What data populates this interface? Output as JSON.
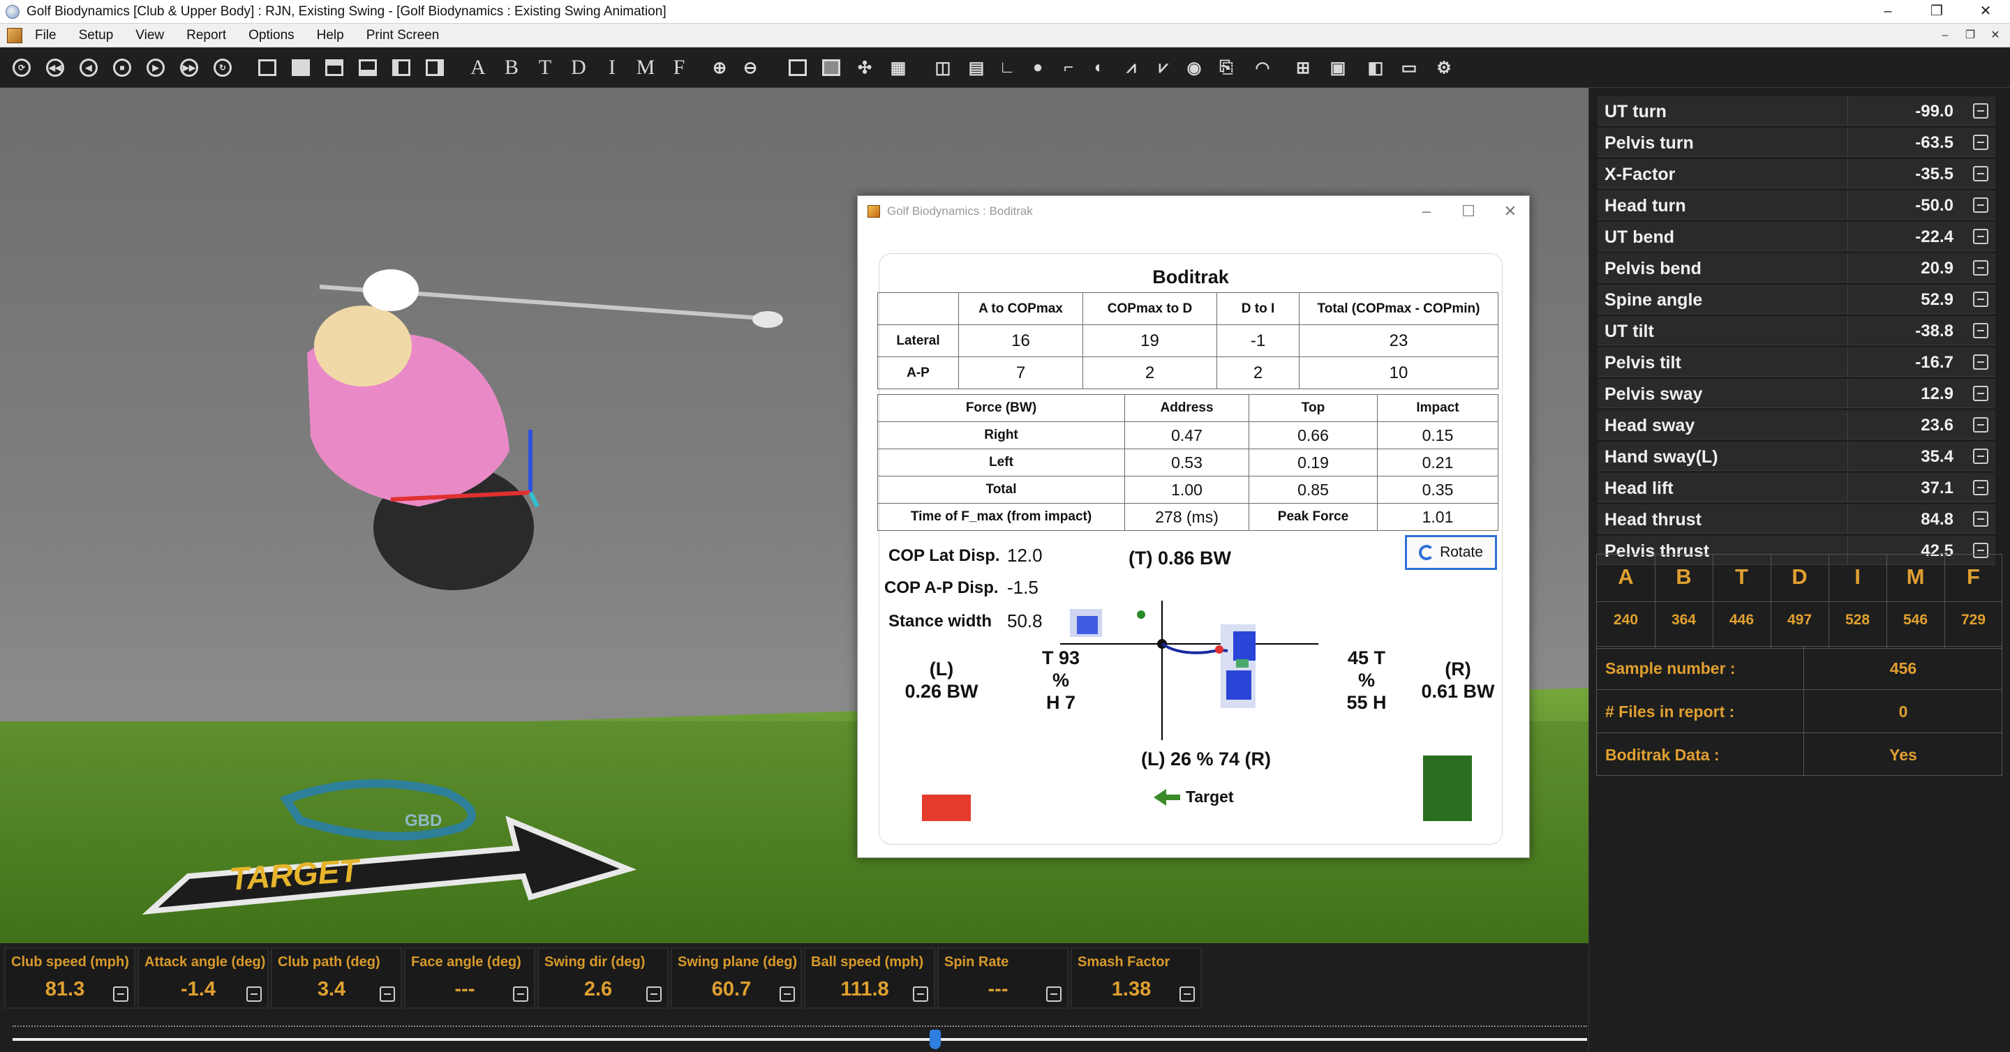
{
  "window": {
    "title": "Golf Biodynamics [Club & Upper Body] : RJN, Existing Swing - [Golf Biodynamics : Existing Swing Animation]",
    "minimize": "–",
    "maximize": "❐",
    "close": "✕"
  },
  "menu": {
    "items": [
      "File",
      "Setup",
      "View",
      "Report",
      "Options",
      "Help",
      "Print Screen"
    ],
    "mdi_minimize": "–",
    "mdi_restore": "❐",
    "mdi_close": "✕"
  },
  "toolbar": {
    "letters": [
      "A",
      "B",
      "T",
      "D",
      "I",
      "M",
      "F"
    ]
  },
  "viewport": {
    "target_sign": "TARGET",
    "logo": "GBD"
  },
  "boditrak": {
    "window_title": "Golf Biodynamics : Boditrak",
    "heading": "Boditrak",
    "table1": {
      "headers": [
        "",
        "A to COPmax",
        "COPmax to D",
        "D to I",
        "Total (COPmax - COPmin)"
      ],
      "rows": [
        {
          "label": "Lateral",
          "values": [
            "16",
            "19",
            "-1",
            "23"
          ]
        },
        {
          "label": "A-P",
          "values": [
            "7",
            "2",
            "2",
            "10"
          ]
        }
      ]
    },
    "table2": {
      "headers": [
        "Force (BW)",
        "Address",
        "Top",
        "Impact"
      ],
      "rows": [
        {
          "label": "Right",
          "values": [
            "0.47",
            "0.66",
            "0.15"
          ]
        },
        {
          "label": "Left",
          "values": [
            "0.53",
            "0.19",
            "0.21"
          ]
        },
        {
          "label": "Total",
          "values": [
            "1.00",
            "0.85",
            "0.35"
          ]
        }
      ],
      "fmax_label": "Time of F_max (from impact)",
      "fmax_value": "278 (ms)",
      "peak_label": "Peak Force",
      "peak_value": "1.01"
    },
    "cop_lat_label": "COP Lat Disp.",
    "cop_lat_value": "12.0",
    "cop_ap_label": "COP A-P Disp.",
    "cop_ap_value": "-1.5",
    "stance_label": "Stance width",
    "stance_value": "50.8",
    "top_bw": "(T) 0.86 BW",
    "left_side": "(L)",
    "left_bw": "0.26 BW",
    "right_side": "(R)",
    "right_bw": "0.61 BW",
    "left_pct_t": "T 93",
    "left_pct": "%",
    "left_pct_h": "H 7",
    "right_pct_t": "45 T",
    "right_pct": "%",
    "right_pct_h": "55 H",
    "bottom_split": "(L) 26 % 74 (R)",
    "rotate_label": "Rotate",
    "target_label": "Target",
    "colors": {
      "left_bar": "#e43b2c",
      "right_bar": "#2b6e20",
      "accent": "#2e6fd8"
    }
  },
  "metrics": [
    {
      "label": "UT turn",
      "value": "-99.0"
    },
    {
      "label": "Pelvis turn",
      "value": "-63.5"
    },
    {
      "label": "X-Factor",
      "value": "-35.5"
    },
    {
      "label": "Head turn",
      "value": "-50.0"
    },
    {
      "label": "UT bend",
      "value": "-22.4"
    },
    {
      "label": "Pelvis bend",
      "value": "20.9"
    },
    {
      "label": "Spine angle",
      "value": "52.9"
    },
    {
      "label": "UT tilt",
      "value": "-38.8"
    },
    {
      "label": "Pelvis tilt",
      "value": "-16.7"
    },
    {
      "label": "Pelvis sway",
      "value": "12.9"
    },
    {
      "label": "Head sway",
      "value": "23.6"
    },
    {
      "label": "Hand sway(L)",
      "value": "35.4"
    },
    {
      "label": "Head lift",
      "value": "37.1"
    },
    {
      "label": "Head thrust",
      "value": "84.8"
    },
    {
      "label": "Pelvis thrust",
      "value": "42.5"
    }
  ],
  "phases": {
    "letters": [
      "A",
      "B",
      "T",
      "D",
      "I",
      "M",
      "F"
    ],
    "frames": [
      "240",
      "364",
      "446",
      "497",
      "528",
      "546",
      "729"
    ]
  },
  "info": {
    "sample_label": "Sample number :",
    "sample_value": "456",
    "files_label": "# Files in report :",
    "files_value": "0",
    "boditrak_label": "Boditrak Data :",
    "boditrak_value": "Yes"
  },
  "stats": [
    {
      "label": "Club speed (mph)",
      "value": "81.3"
    },
    {
      "label": "Attack angle (deg)",
      "value": "-1.4"
    },
    {
      "label": "Club path (deg)",
      "value": "3.4"
    },
    {
      "label": "Face angle (deg)",
      "value": "---"
    },
    {
      "label": "Swing dir (deg)",
      "value": "2.6"
    },
    {
      "label": "Swing plane (deg)",
      "value": "60.7"
    },
    {
      "label": "Ball speed (mph)",
      "value": "111.8"
    },
    {
      "label": "Spin Rate",
      "value": "---"
    },
    {
      "label": "Smash Factor",
      "value": "1.38"
    }
  ],
  "timeline": {
    "position": 0.59
  }
}
